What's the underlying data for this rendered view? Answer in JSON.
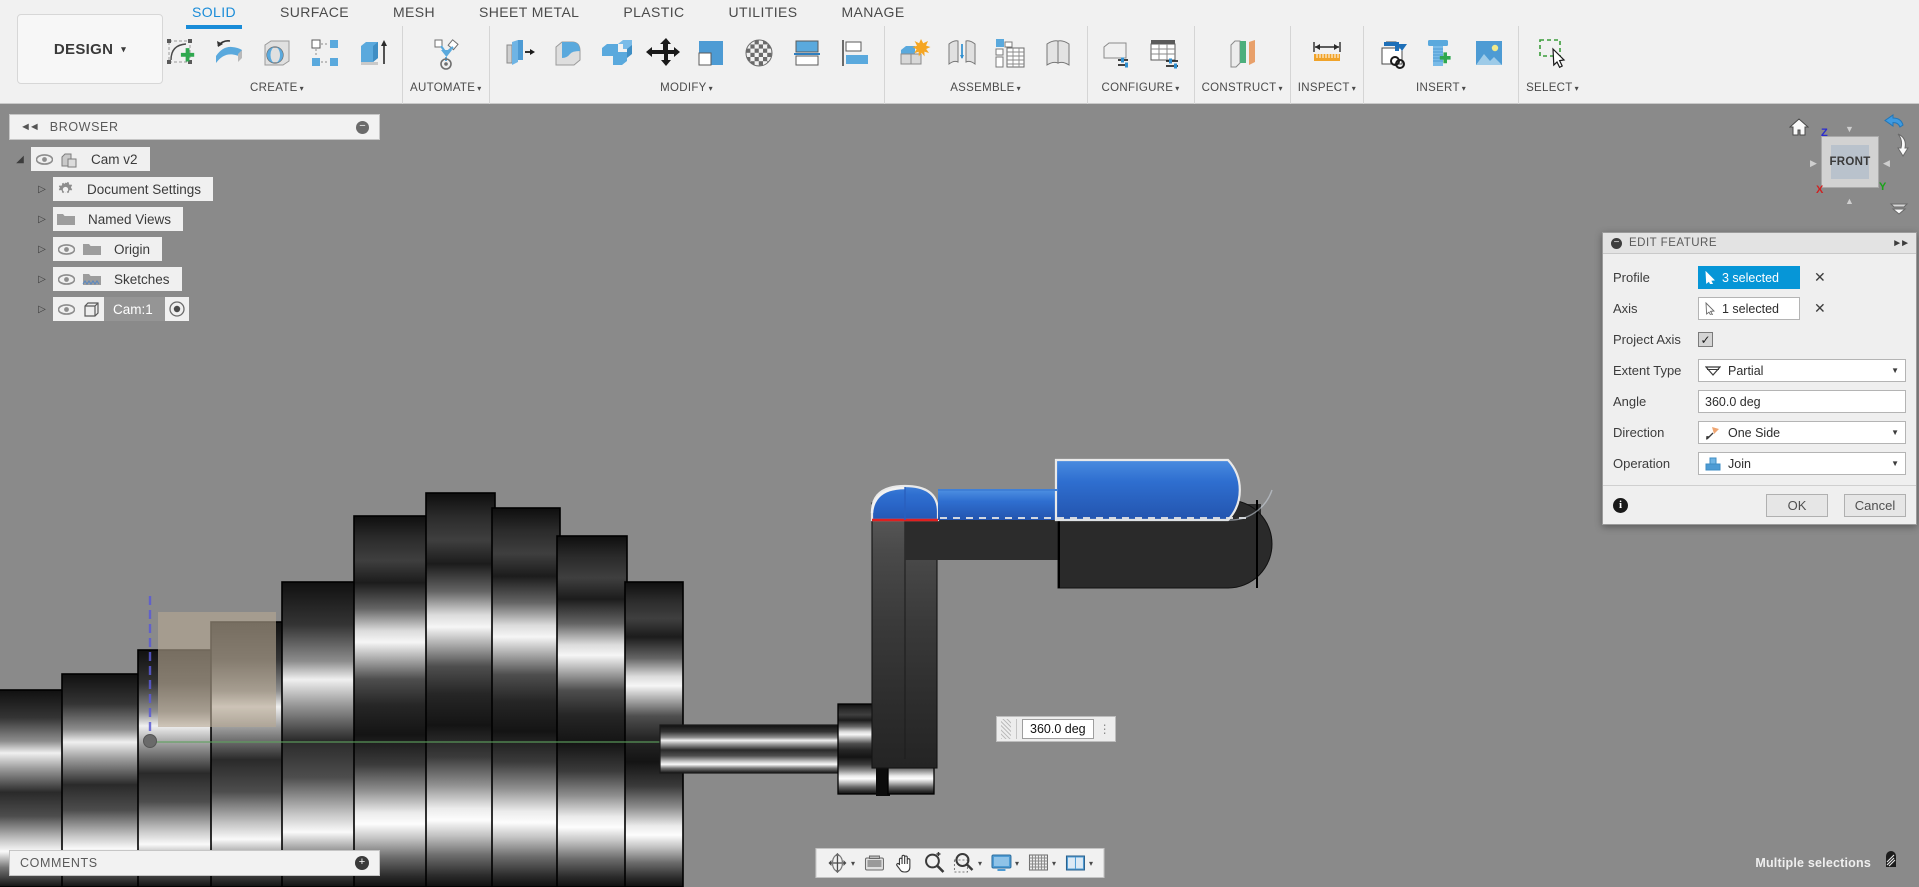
{
  "app": {
    "workspace_label": "DESIGN",
    "workspace_caret": "▾"
  },
  "ribbon": {
    "tabs": [
      {
        "label": "SOLID",
        "active": true
      },
      {
        "label": "SURFACE",
        "active": false
      },
      {
        "label": "MESH",
        "active": false
      },
      {
        "label": "SHEET METAL",
        "active": false
      },
      {
        "label": "PLASTIC",
        "active": false
      },
      {
        "label": "UTILITIES",
        "active": false
      },
      {
        "label": "MANAGE",
        "active": false
      }
    ],
    "panels": [
      {
        "label": "CREATE",
        "caret": "▾",
        "icons": [
          "create-sketch-icon",
          "revolve-icon",
          "sphere-icon",
          "pattern-icon",
          "extrude-icon"
        ]
      },
      {
        "label": "AUTOMATE",
        "caret": "▾",
        "icons": [
          "automate-icon"
        ]
      },
      {
        "label": "MODIFY",
        "caret": "▾",
        "icons": [
          "press-pull-icon",
          "fillet-icon",
          "shell-icon",
          "move-copy-icon",
          "combine-icon",
          "material-icon",
          "split-face-icon",
          "align-icon"
        ]
      },
      {
        "label": "ASSEMBLE",
        "caret": "▾",
        "icons": [
          "new-component-icon",
          "joint-icon",
          "as-built-joint-icon",
          "rigid-group-icon"
        ]
      },
      {
        "label": "CONFIGURE",
        "caret": "▾",
        "icons": [
          "configure-model-icon",
          "configuration-table-icon"
        ]
      },
      {
        "label": "CONSTRUCT",
        "caret": "▾",
        "icons": [
          "offset-plane-icon"
        ]
      },
      {
        "label": "INSPECT",
        "caret": "▾",
        "icons": [
          "measure-icon"
        ]
      },
      {
        "label": "INSERT",
        "caret": "▾",
        "icons": [
          "insert-derive-icon",
          "insert-mcmaster-icon",
          "insert-canvas-icon"
        ]
      },
      {
        "label": "SELECT",
        "caret": "▾",
        "icons": [
          "select-window-icon"
        ]
      }
    ]
  },
  "browser": {
    "title": "BROWSER",
    "collapse_icon": "collapse-left-icon",
    "minimize_icon": "minimize-icon",
    "items": [
      {
        "label": "Cam v2",
        "expander": "▰",
        "icon": "component-icon",
        "eye": true,
        "selected": false,
        "indent": 0,
        "extra": null
      },
      {
        "label": "Document Settings",
        "expander": "▷",
        "icon": "gear-icon",
        "eye": false,
        "selected": false,
        "indent": 1,
        "extra": null
      },
      {
        "label": "Named Views",
        "expander": "▷",
        "icon": "folder-icon",
        "eye": false,
        "selected": false,
        "indent": 1,
        "extra": null
      },
      {
        "label": "Origin",
        "expander": "▷",
        "icon": "folder-icon",
        "eye": true,
        "selected": false,
        "indent": 1,
        "extra": null
      },
      {
        "label": "Sketches",
        "expander": "▷",
        "icon": "folder-sketch-icon",
        "eye": true,
        "selected": false,
        "indent": 1,
        "extra": null
      },
      {
        "label": "Cam:1",
        "expander": "▷",
        "icon": "body-icon",
        "eye": true,
        "selected": true,
        "indent": 1,
        "extra": "radio-icon"
      }
    ]
  },
  "comments": {
    "label": "COMMENTS",
    "add_icon": "add-comment-icon"
  },
  "viewcube": {
    "home_icon": "home-icon",
    "face_label": "FRONT",
    "axis_z": "Z",
    "axis_x": "X",
    "axis_y": "Y",
    "undo_view_icon": "undo-view-icon",
    "rotate_icon": "rotate-view-icon",
    "menu_icon": "viewcube-menu-icon"
  },
  "edit_feature": {
    "title": "EDIT FEATURE",
    "collapse_icon": "collapse-dialog-icon",
    "expand_icon": "expand-dialog-icon",
    "rows": {
      "profile": {
        "label": "Profile",
        "value": "3 selected",
        "icon": "cursor-select-icon",
        "clear_icon": "✕",
        "active": true
      },
      "axis": {
        "label": "Axis",
        "value": "1 selected",
        "icon": "cursor-select-icon",
        "clear_icon": "✕",
        "active": false
      },
      "project_axis": {
        "label": "Project Axis",
        "checked": true,
        "check_glyph": "✓"
      },
      "extent_type": {
        "label": "Extent Type",
        "value": "Partial",
        "icon": "partial-extent-icon",
        "caret": "▼"
      },
      "angle": {
        "label": "Angle",
        "value": "360.0 deg"
      },
      "direction": {
        "label": "Direction",
        "value": "One Side",
        "icon": "one-side-icon",
        "caret": "▼"
      },
      "operation": {
        "label": "Operation",
        "value": "Join",
        "icon": "join-icon",
        "caret": "▼"
      }
    },
    "info_icon": "info-icon",
    "ok_label": "OK",
    "cancel_label": "Cancel"
  },
  "canvas": {
    "dimension": {
      "value": "360.0 deg",
      "grip_icon": "drag-grip-icon",
      "menu_icon": "dimension-menu-icon"
    }
  },
  "navbar": {
    "items": [
      {
        "name": "orbit-icon",
        "caret": "▾"
      },
      {
        "name": "pan-view-icon",
        "caret": ""
      },
      {
        "name": "pan-hand-icon",
        "caret": ""
      },
      {
        "name": "zoom-in-icon",
        "caret": ""
      },
      {
        "name": "zoom-window-icon",
        "caret": "▾"
      },
      {
        "name": "display-settings-icon",
        "caret": "▾"
      },
      {
        "name": "grid-snaps-icon",
        "caret": "▾"
      },
      {
        "name": "viewports-icon",
        "caret": "▾"
      }
    ]
  },
  "status": {
    "text": "Multiple selections",
    "icon": "selection-filter-icon"
  }
}
